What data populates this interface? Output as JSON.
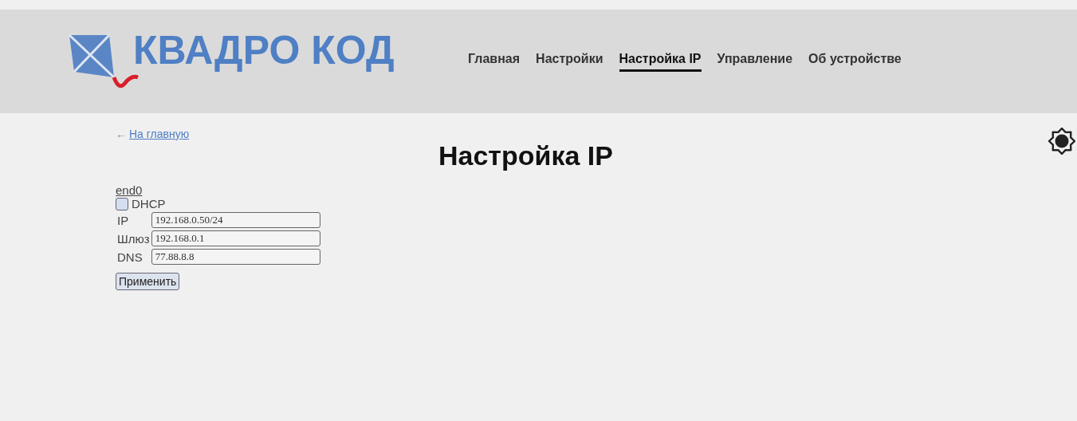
{
  "logo": {
    "text": "КВАДРО КОД"
  },
  "nav": [
    {
      "label": "Главная",
      "selected": false
    },
    {
      "label": "Настройки",
      "selected": false
    },
    {
      "label": "Настройка IP",
      "selected": true
    },
    {
      "label": "Управление",
      "selected": false
    },
    {
      "label": "Об устройстве",
      "selected": false
    }
  ],
  "back": {
    "arrow": "←",
    "label": "На главную"
  },
  "title": "Настройка IP",
  "interface": {
    "name": "end0",
    "dhcp": {
      "label": "DHCP",
      "checked": false
    },
    "fields": [
      {
        "label": "IP",
        "value": "192.168.0.50/24"
      },
      {
        "label": "Шлюз",
        "value": "192.168.0.1"
      },
      {
        "label": "DNS",
        "value": "77.88.8.8"
      }
    ],
    "button": "Применить"
  }
}
